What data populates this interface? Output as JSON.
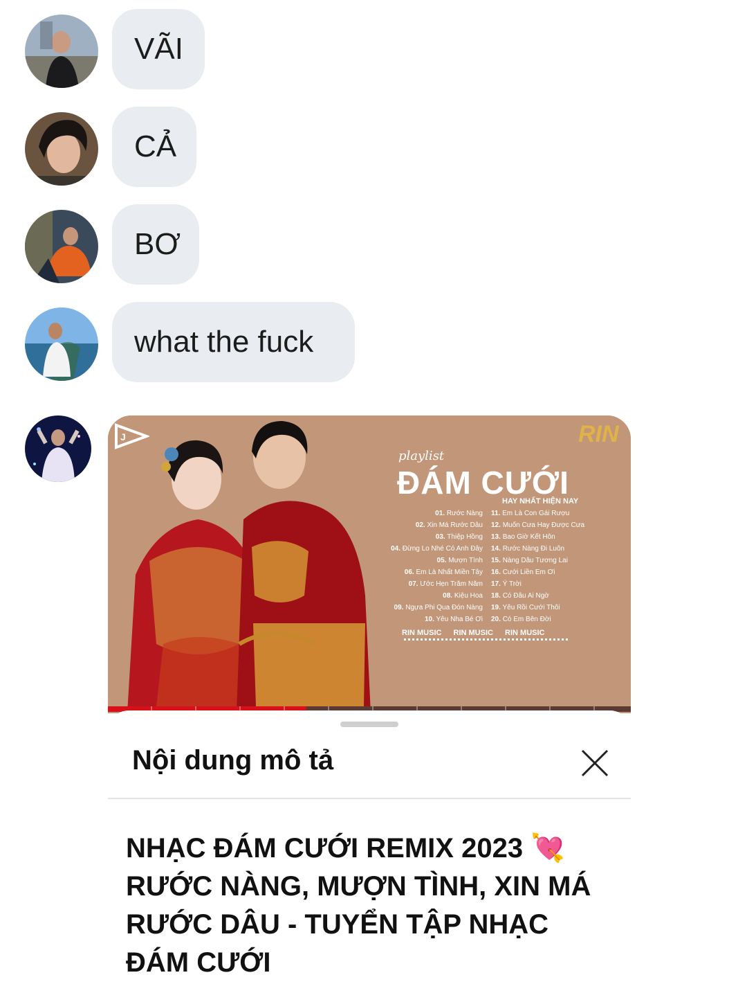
{
  "messages": [
    {
      "text": "VÃI"
    },
    {
      "text": "CẢ"
    },
    {
      "text": "BƠ"
    },
    {
      "text": "what the fuck"
    }
  ],
  "card": {
    "thumbnail": {
      "playlist_label": "playlist",
      "title": "ĐÁM CƯỚI",
      "subtitle": "HAY NHẤT HIỆN NAY",
      "brand": "RIN",
      "tracks_left": [
        {
          "num": "01.",
          "name": "Rước Nàng"
        },
        {
          "num": "02.",
          "name": "Xin Má Rước Dâu"
        },
        {
          "num": "03.",
          "name": "Thiệp Hồng"
        },
        {
          "num": "04.",
          "name": "Đừng Lo Nhé Có Anh Đây"
        },
        {
          "num": "05.",
          "name": "Mượn Tình"
        },
        {
          "num": "06.",
          "name": "Em Là Nhất Miền Tây"
        },
        {
          "num": "07.",
          "name": "Ước Hẹn Trăm Năm"
        },
        {
          "num": "08.",
          "name": "Kiệu Hoa"
        },
        {
          "num": "09.",
          "name": "Ngựa Phi Qua Đón Nàng"
        },
        {
          "num": "10.",
          "name": "Yêu Nha Bé Ơi"
        }
      ],
      "tracks_right": [
        {
          "num": "11.",
          "name": "Em Là Con Gái Rượu"
        },
        {
          "num": "12.",
          "name": "Muốn Cưa Hay Được Cưa"
        },
        {
          "num": "13.",
          "name": "Bao Giờ Kết Hôn"
        },
        {
          "num": "14.",
          "name": "Rước Nàng Đi Luôn"
        },
        {
          "num": "15.",
          "name": "Nàng Dâu Tương Lai"
        },
        {
          "num": "16.",
          "name": "Cưới Liền Em Ơi"
        },
        {
          "num": "17.",
          "name": "Ý Trời"
        },
        {
          "num": "18.",
          "name": "Có Đâu Ai Ngờ"
        },
        {
          "num": "19.",
          "name": "Yêu Rồi Cưới Thôi"
        },
        {
          "num": "20.",
          "name": "Có Em Bên Đời"
        }
      ],
      "socials": [
        "RIN MUSIC",
        "RIN MUSIC",
        "RIN MUSIC"
      ]
    },
    "progress": 0.38,
    "sheet_title": "Nội dung mô tả",
    "video_title": "NHẠC ĐÁM CƯỚI REMIX 2023 💘 RƯỚC NÀNG, MƯỢN TÌNH, XIN MÁ RƯỚC DÂU - TUYỂN TẬP NHẠC ĐÁM CƯỚI",
    "close_icon": "close-icon"
  },
  "colors": {
    "bubble": "#e9ecf0",
    "thumb_bg": "#c19679",
    "progress": "#d8101c"
  }
}
